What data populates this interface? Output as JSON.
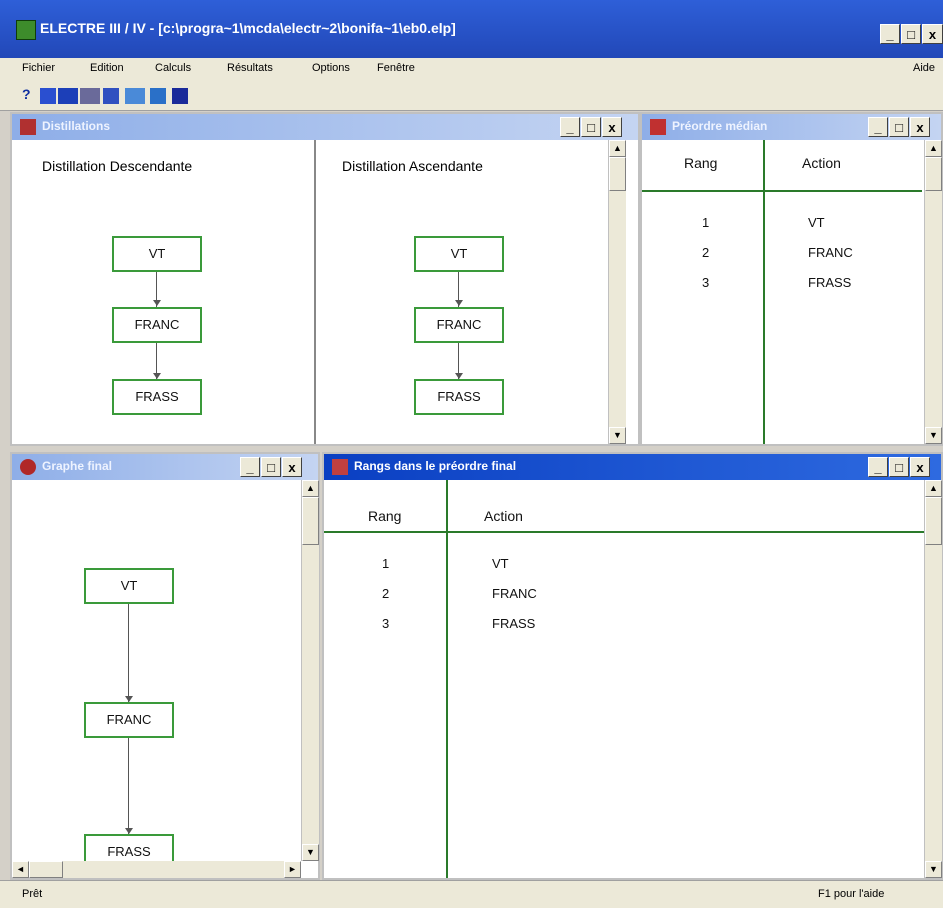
{
  "window": {
    "title": "ELECTRE  III / IV - [c:\\progra~1\\mcda\\electr~2\\bonifa~1\\eb0.elp]",
    "min_label": "_",
    "max_label": "□",
    "close_label": "x"
  },
  "menu": {
    "items": [
      "Fichier",
      "Edition",
      "Calculs",
      "Résultats",
      "Options",
      "Fenêtre"
    ],
    "help": "Aide"
  },
  "toolbar": {
    "help_label": "?",
    "icons": [
      "arrow-right-icon",
      "arrows-icon",
      "print-icon",
      "table-icon",
      "chart-icon",
      "save-icon"
    ]
  },
  "distillations": {
    "title": "Distillations",
    "descending": {
      "title": "Distillation Descendante",
      "nodes": [
        "VT",
        "FRANC",
        "FRASS"
      ]
    },
    "ascending": {
      "title": "Distillation Ascendante",
      "nodes": [
        "VT",
        "FRANC",
        "FRASS"
      ]
    }
  },
  "median": {
    "title": "Préordre médian",
    "headers": {
      "rank": "Rang",
      "action": "Action"
    },
    "rows": [
      {
        "rank": "1",
        "action": "VT"
      },
      {
        "rank": "2",
        "action": "FRANC"
      },
      {
        "rank": "3",
        "action": "FRASS"
      }
    ]
  },
  "final_graph": {
    "title": "Graphe final",
    "nodes": [
      "VT",
      "FRANC",
      "FRASS"
    ]
  },
  "final_ranks": {
    "title": "Rangs dans le préordre final",
    "headers": {
      "rank": "Rang",
      "action": "Action"
    },
    "rows": [
      {
        "rank": "1",
        "action": "VT"
      },
      {
        "rank": "2",
        "action": "FRANC"
      },
      {
        "rank": "3",
        "action": "FRASS"
      }
    ]
  },
  "scroll": {
    "up": "▲",
    "down": "▼",
    "left": "◄",
    "right": "►"
  },
  "status": {
    "left": "Prêt",
    "right": "F1 pour l'aide"
  },
  "colors": {
    "title_active": "#0a3fc2",
    "title_inactive": "#8eaee8",
    "node_border": "#3a9a3a",
    "divider": "#2a7a2a"
  }
}
